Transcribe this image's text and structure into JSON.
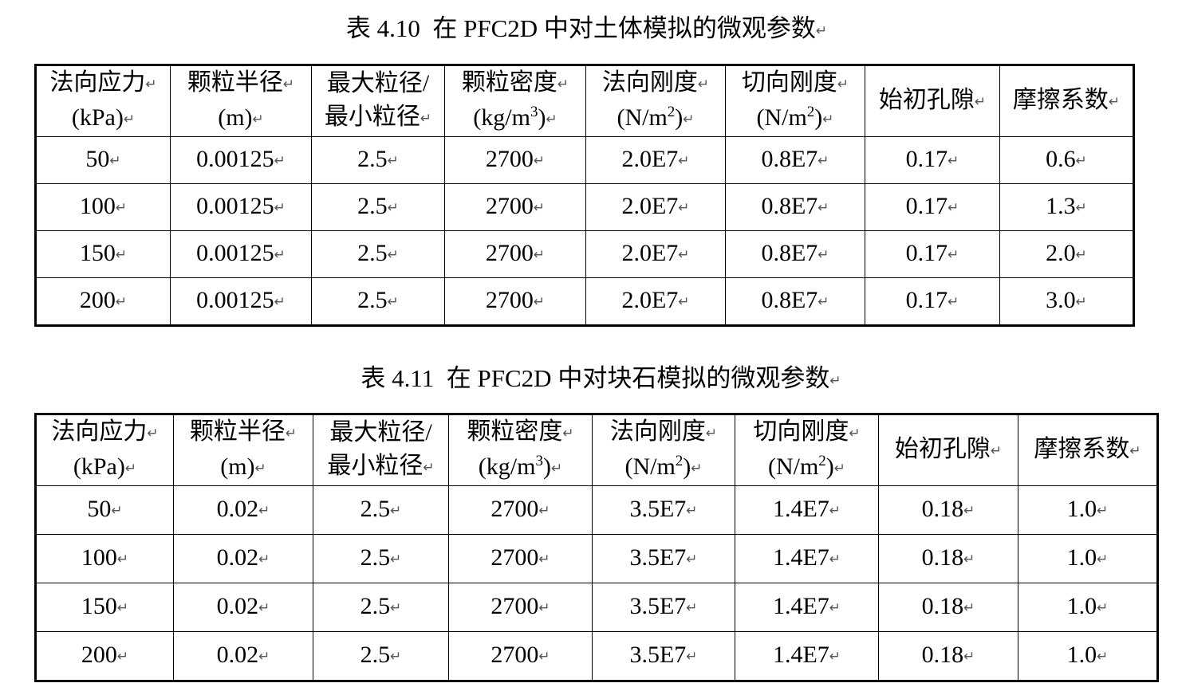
{
  "tables": [
    {
      "caption": "表 4.10  在 PFC2D 中对土体模拟的微观参数",
      "headers": [
        {
          "line1": "法向应力",
          "line2": "(kPa)"
        },
        {
          "line1": "颗粒半径",
          "line2": "(m)"
        },
        {
          "line1": "最大粒径/",
          "line2": "最小粒径"
        },
        {
          "line1": "颗粒密度",
          "line2_pre": "(kg/m",
          "line2_sup": "3",
          "line2_post": ")"
        },
        {
          "line1": "法向刚度",
          "line2_pre": "(N/m",
          "line2_sup": "2",
          "line2_post": ")"
        },
        {
          "line1": "切向刚度",
          "line2_pre": "(N/m",
          "line2_sup": "2",
          "line2_post": ")"
        },
        {
          "line1": "始初孔隙"
        },
        {
          "line1": "摩擦系数"
        }
      ],
      "rows": [
        [
          "50",
          "0.00125",
          "2.5",
          "2700",
          "2.0E7",
          "0.8E7",
          "0.17",
          "0.6"
        ],
        [
          "100",
          "0.00125",
          "2.5",
          "2700",
          "2.0E7",
          "0.8E7",
          "0.17",
          "1.3"
        ],
        [
          "150",
          "0.00125",
          "2.5",
          "2700",
          "2.0E7",
          "0.8E7",
          "0.17",
          "2.0"
        ],
        [
          "200",
          "0.00125",
          "2.5",
          "2700",
          "2.0E7",
          "0.8E7",
          "0.17",
          "3.0"
        ]
      ]
    },
    {
      "caption": "表 4.11  在 PFC2D 中对块石模拟的微观参数",
      "headers": [
        {
          "line1": "法向应力",
          "line2": "(kPa)"
        },
        {
          "line1": "颗粒半径",
          "line2": "(m)"
        },
        {
          "line1": "最大粒径/",
          "line2": "最小粒径"
        },
        {
          "line1": "颗粒密度",
          "line2_pre": "(kg/m",
          "line2_sup": "3",
          "line2_post": ")"
        },
        {
          "line1": "法向刚度",
          "line2_pre": "(N/m",
          "line2_sup": "2",
          "line2_post": ")"
        },
        {
          "line1": "切向刚度",
          "line2_pre": "(N/m",
          "line2_sup": "2",
          "line2_post": ")"
        },
        {
          "line1": "始初孔隙"
        },
        {
          "line1": "摩擦系数"
        }
      ],
      "rows": [
        [
          "50",
          "0.02",
          "2.5",
          "2700",
          "3.5E7",
          "1.4E7",
          "0.18",
          "1.0"
        ],
        [
          "100",
          "0.02",
          "2.5",
          "2700",
          "3.5E7",
          "1.4E7",
          "0.18",
          "1.0"
        ],
        [
          "150",
          "0.02",
          "2.5",
          "2700",
          "3.5E7",
          "1.4E7",
          "0.18",
          "1.0"
        ],
        [
          "200",
          "0.02",
          "2.5",
          "2700",
          "3.5E7",
          "1.4E7",
          "0.18",
          "1.0"
        ]
      ]
    }
  ],
  "paragraph_mark": "↵"
}
